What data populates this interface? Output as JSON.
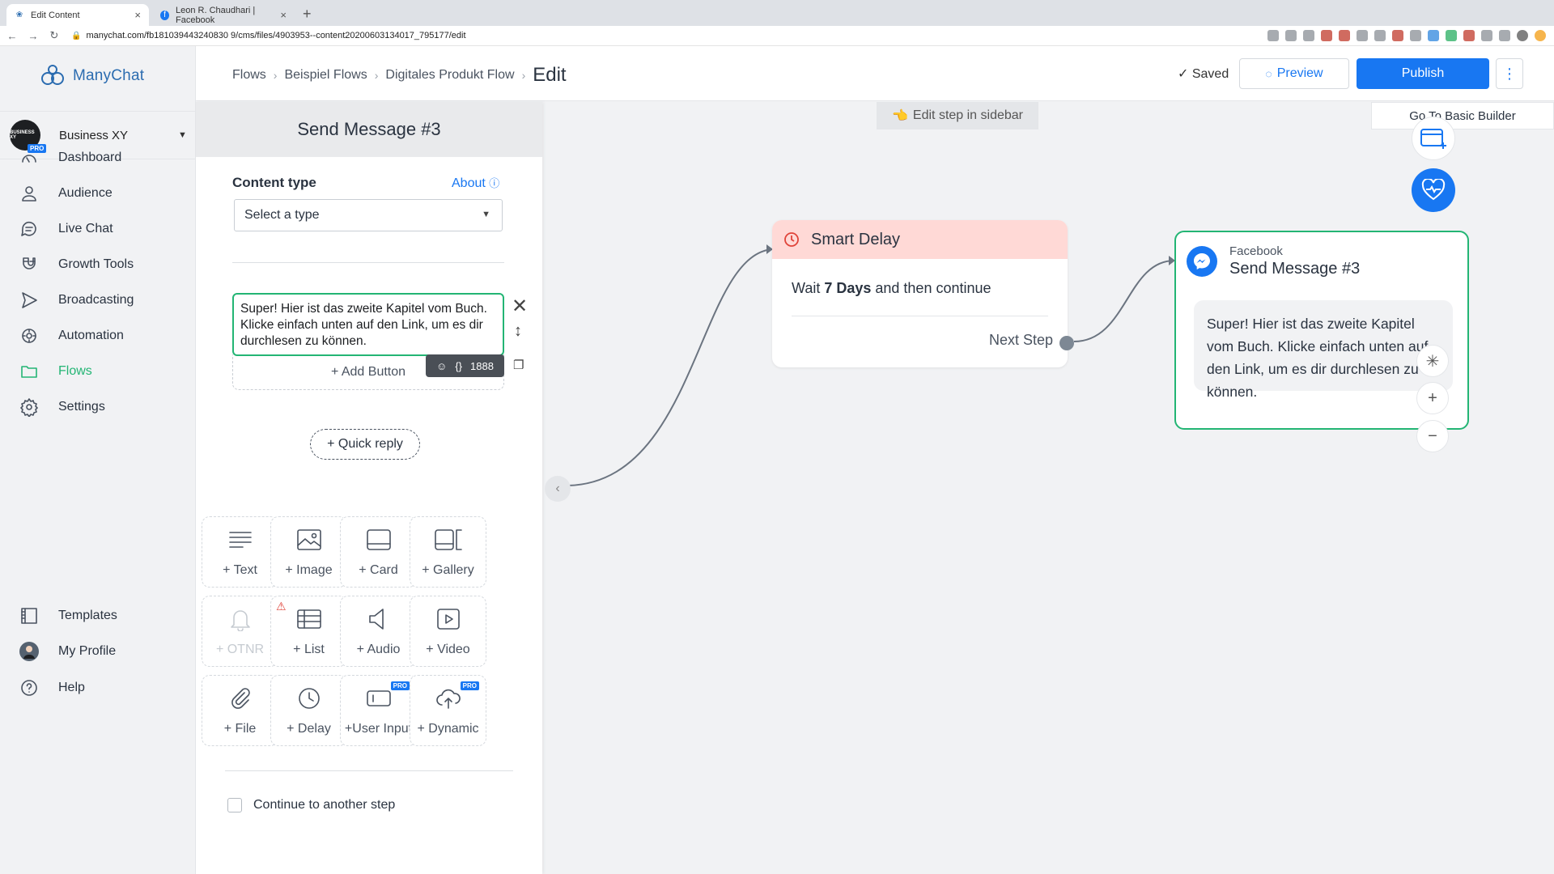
{
  "browser": {
    "tabs": [
      {
        "title": "Edit Content",
        "active": true
      },
      {
        "title": "Leon R. Chaudhari | Facebook",
        "active": false
      }
    ],
    "url": "manychat.com/fb181039443240830 9/cms/files/4903953--content20200603134017_795177/edit"
  },
  "app": {
    "brand": "ManyChat",
    "account": {
      "name": "Business XY",
      "avatar_text": "BUSINESS XY",
      "badge": "PRO"
    },
    "nav": [
      {
        "label": "Dashboard",
        "icon": "gauge-icon"
      },
      {
        "label": "Audience",
        "icon": "user-icon"
      },
      {
        "label": "Live Chat",
        "icon": "chat-icon"
      },
      {
        "label": "Growth Tools",
        "icon": "magnet-icon"
      },
      {
        "label": "Broadcasting",
        "icon": "send-icon"
      },
      {
        "label": "Automation",
        "icon": "automation-icon"
      },
      {
        "label": "Flows",
        "icon": "folder-icon",
        "active": true
      },
      {
        "label": "Settings",
        "icon": "gear-icon"
      }
    ],
    "nav_bottom": [
      {
        "label": "Templates",
        "icon": "templates-icon"
      },
      {
        "label": "My Profile",
        "icon": "profile-avatar-icon"
      },
      {
        "label": "Help",
        "icon": "help-icon"
      }
    ]
  },
  "header": {
    "breadcrumb": [
      "Flows",
      "Beispiel Flows",
      "Digitales Produkt Flow"
    ],
    "current": "Edit",
    "saved": "✓ Saved",
    "preview": "Preview",
    "publish": "Publish"
  },
  "canvas": {
    "edit_hint": "Edit step in sidebar",
    "basic_builder": "Go To Basic Builder",
    "delay_node": {
      "title": "Smart Delay",
      "text_before": "Wait ",
      "text_bold": "7 Days",
      "text_after": " and then continue",
      "next_step": "Next Step"
    },
    "message_node": {
      "platform": "Facebook",
      "title": "Send Message #3",
      "text": "Super! Hier ist das zweite Kapitel vom Buch. Klicke einfach unten auf den Link, um es dir durchlesen zu können."
    }
  },
  "panel": {
    "title": "Send Message #3",
    "content_type_label": "Content type",
    "about": "About",
    "select_placeholder": "Select a type",
    "message_text": "Super! Hier ist das zweite Kapitel vom Buch. Klicke einfach unten auf den Link, um es dir durchlesen zu können.",
    "add_button": "+ Add Button",
    "char_count": "1888",
    "quick_reply": "+ Quick reply",
    "tiles": [
      {
        "label": "+ Text",
        "icon": "text-icon"
      },
      {
        "label": "+ Image",
        "icon": "image-icon"
      },
      {
        "label": "+ Card",
        "icon": "card-icon"
      },
      {
        "label": "+ Gallery",
        "icon": "gallery-icon"
      },
      {
        "label": "+ OTNR",
        "icon": "bell-icon",
        "disabled": true
      },
      {
        "label": "+ List",
        "icon": "list-icon",
        "warning": true
      },
      {
        "label": "+ Audio",
        "icon": "audio-icon"
      },
      {
        "label": "+ Video",
        "icon": "video-icon"
      },
      {
        "label": "+ File",
        "icon": "paperclip-icon"
      },
      {
        "label": "+ Delay",
        "icon": "clock-icon"
      },
      {
        "label": "+User Input",
        "icon": "user-input-icon",
        "badge": "PRO"
      },
      {
        "label": "+ Dynamic",
        "icon": "cloud-icon",
        "badge": "PRO"
      }
    ],
    "continue_label": "Continue to another step"
  },
  "colors": {
    "accent": "#1877f2",
    "green": "#23b574",
    "delay_header": "#ffd9d6"
  }
}
